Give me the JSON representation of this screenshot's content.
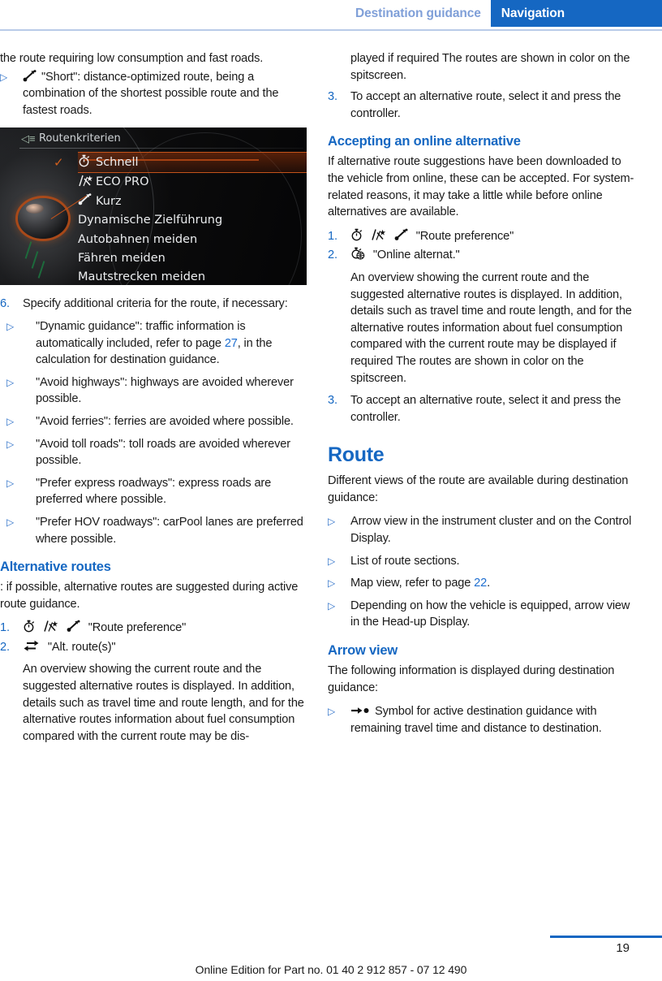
{
  "header": {
    "chapter": "Destination guidance",
    "section": "Navigation"
  },
  "left_column": {
    "continued_paragraph": "the route requiring low consumption and fast roads.",
    "short_bullet": "\"Short\": distance-optimized route, being a combination of the shortest possible route and the fastest roads.",
    "figure": {
      "title": "Routenkriterien",
      "rows": [
        {
          "label": "Schnell",
          "icon": "stopwatch-icon",
          "selected": true
        },
        {
          "label": "ECO PRO",
          "icon": "eco-pro-icon",
          "selected": false
        },
        {
          "label": "Kurz",
          "icon": "short-route-icon",
          "selected": false
        },
        {
          "label": "Dynamische Zielführung",
          "icon": "",
          "selected": false
        },
        {
          "label": "Autobahnen meiden",
          "icon": "",
          "selected": false
        },
        {
          "label": "Fähren meiden",
          "icon": "",
          "selected": false
        },
        {
          "label": "Mautstrecken meiden",
          "icon": "",
          "selected": false
        }
      ]
    },
    "step6_number": "6.",
    "step6_text": "Specify additional criteria for the route, if necessary:",
    "criteria": [
      "\"Dynamic guidance\": traffic information is automatically included, refer to page 27, in the calculation for destination guidance.",
      "\"Avoid highways\": highways are avoided wherever possible.",
      "\"Avoid ferries\": ferries are avoided where possible.",
      "\"Avoid toll roads\": toll roads are avoided wherever possible.",
      "\"Prefer express roadways\": express roads are preferred where possible.",
      "\"Prefer HOV roadways\": carPool lanes are preferred where possible."
    ],
    "criteria_parts": {
      "dynamic_pre": "\"Dynamic guidance\": traffic information is automatically included, refer to page ",
      "dynamic_page": "27",
      "dynamic_post": ", in the calculation for destination guidance."
    },
    "alt_routes_heading": "Alternative routes",
    "alt_routes_intro": ": if possible, alternative routes are suggested during active route guidance.",
    "steps": [
      {
        "number": "1.",
        "label": "\"Route preference\""
      },
      {
        "number": "2.",
        "label": "\"Alt. route(s)\""
      }
    ],
    "overview_paragraph": "An overview showing the current route and the suggested alternative routes is displayed. In addition, details such as travel time and route length, and for the alternative routes information about fuel consumption compared with the current route may be dis-"
  },
  "right_column": {
    "overview_continued": "played if required The routes are shown in color on the spitscreen.",
    "step3_number": "3.",
    "step3_text": "To accept an alternative route, select it and press the controller.",
    "online_heading": "Accepting an online alternative",
    "online_intro": "If alternative route suggestions have been downloaded to the vehicle from online, these can be accepted. For system-related reasons, it may take a little while before online alternatives are available.",
    "online_steps": [
      {
        "number": "1.",
        "label": "\"Route preference\""
      },
      {
        "number": "2.",
        "label": "\"Online alternat.\""
      }
    ],
    "online_overview": "An overview showing the current route and the suggested alternative routes is displayed. In addition, details such as travel time and route length, and for the alternative routes information about fuel consumption compared with the current route may be displayed if required The routes are shown in color on the spitscreen.",
    "online_step3_number": "3.",
    "online_step3_text": "To accept an alternative route, select it and press the controller.",
    "route_heading": "Route",
    "route_intro": "Different views of the route are available during destination guidance:",
    "route_bullets": [
      {
        "text": "Arrow view in the instrument cluster and on the Control Display."
      },
      {
        "text": "List of route sections."
      },
      {
        "pre": "Map view, refer to page ",
        "page": "22",
        "post": "."
      },
      {
        "text": "Depending on how the vehicle is equipped, arrow view in the Head-up Display."
      }
    ],
    "arrow_heading": "Arrow view",
    "arrow_intro": "The following information is displayed during destination guidance:",
    "arrow_bullet": "Symbol for active destination guidance with remaining travel time and distance to destination."
  },
  "footer": {
    "note": "Online Edition for Part no. 01 40 2 912 857 - 07 12 490",
    "page_number": "19"
  },
  "colors": {
    "brand_blue": "#1567c2",
    "header_chapter": "#7f9fd8",
    "link_blue": "#1f6fd0",
    "rule_blue": "#b9cbe8"
  }
}
